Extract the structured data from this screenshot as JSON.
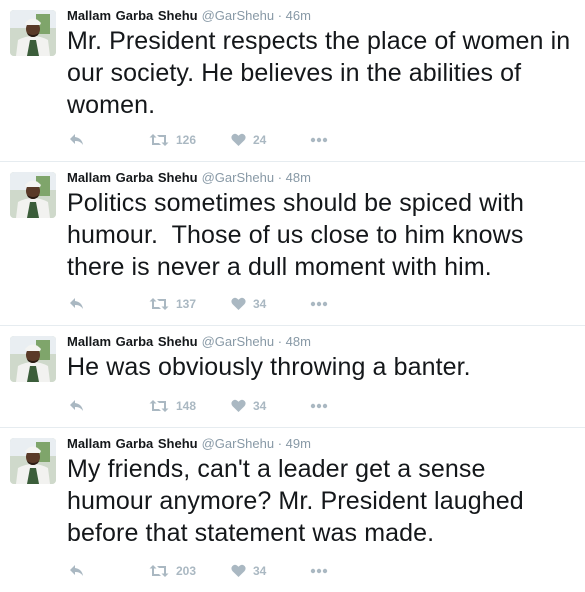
{
  "tweets": [
    {
      "author": "Mallam Garba Shehu",
      "handle": "@GarShehu",
      "separator": "·",
      "time": "46m",
      "text": "Mr. President respects the place of women in our society. He believes in the abilities of women.",
      "retweets": "126",
      "likes": "24"
    },
    {
      "author": "Mallam Garba Shehu",
      "handle": "@GarShehu",
      "separator": "·",
      "time": "48m",
      "text": "Politics sometimes should be spiced with humour.  Those of us close to him knows there is never a dull moment with him.",
      "retweets": "137",
      "likes": "34"
    },
    {
      "author": "Mallam Garba Shehu",
      "handle": "@GarShehu",
      "separator": "·",
      "time": "48m",
      "text": "He was obviously throwing a banter.",
      "retweets": "148",
      "likes": "34"
    },
    {
      "author": "Mallam Garba Shehu",
      "handle": "@GarShehu",
      "separator": "·",
      "time": "49m",
      "text": "My friends, can't a leader get a sense humour anymore? Mr. President laughed before that statement was made.",
      "retweets": "203",
      "likes": "34"
    }
  ],
  "colors": {
    "name": "#14171a",
    "meta": "#8899a6",
    "action_icon": "#aab8c2",
    "divider": "#e6ecf0"
  },
  "icons": {
    "reply": "reply-icon",
    "retweet": "retweet-icon",
    "like": "heart-icon",
    "more": "more-icon"
  }
}
